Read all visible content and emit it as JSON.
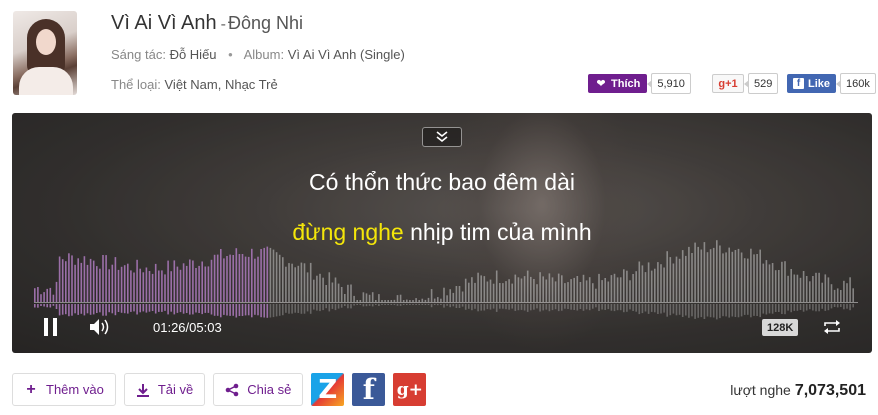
{
  "song": {
    "title": "Vì Ai Vì Anh",
    "separator": "-",
    "artist": "Đông Nhi",
    "composer_label": "Sáng tác:",
    "composer": "Đỗ Hiếu",
    "album_label": "Album:",
    "album": "Vì Ai Vì Anh (Single)",
    "genre_label": "Thể loại:",
    "genre": "Việt Nam, Nhạc Trẻ"
  },
  "social": {
    "like_label": "Thích",
    "like_count": "5,910",
    "gplus_label": "+1",
    "gplus_count": "529",
    "fb_label": "Like",
    "fb_count": "160k"
  },
  "player": {
    "lyric_line1": "Có thổn thức bao đêm dài",
    "lyric_line2_highlight": "đừng nghe",
    "lyric_line2_rest": " nhịp tim của mình",
    "time_current": "01:26",
    "time_sep": " / ",
    "time_total": "05:03",
    "progress": 0.284,
    "quality": "128K",
    "highlight_color": "#f4e60a",
    "played_color": "#9b6fa8"
  },
  "actions": {
    "add_label": "Thêm vào",
    "download_label": "Tải về",
    "share_label": "Chia sẻ",
    "zing_letter": "Z",
    "facebook_letter": "f",
    "gplus_letter": "g+"
  },
  "stats": {
    "plays_label": "lượt nghe",
    "plays_count": "7,073,501"
  },
  "colors": {
    "brand": "#6f1e8e",
    "facebook": "#3b5998",
    "gplus": "#d73d32"
  }
}
